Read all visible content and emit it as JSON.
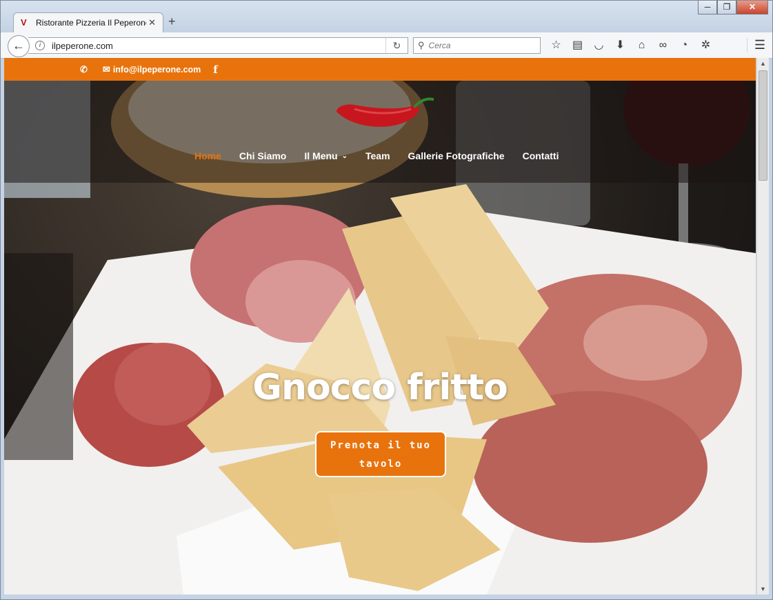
{
  "browser": {
    "tab_title": "Ristorante Pizzeria Il Peperone",
    "tab_close": "✕",
    "new_tab": "+",
    "url": "ilpeperone.com",
    "search_placeholder": "Cerca",
    "window_controls": [
      "─",
      "❐",
      "✕"
    ],
    "toolbar_icons": [
      "star-icon",
      "reader-icon",
      "pocket-icon",
      "download-icon",
      "home-icon",
      "mask-icon",
      "history-icon",
      "puzzle-icon"
    ]
  },
  "site": {
    "topbar": {
      "phone_icon": "phone-icon",
      "email": "info@ilpeperone.com",
      "facebook_icon": "f"
    },
    "nav": {
      "items": [
        "Home",
        "Chi Siamo",
        "Il Menu",
        "Team",
        "Gallerie Fotografiche",
        "Contatti"
      ],
      "active": "Home"
    },
    "hero": {
      "title": "Gnocco fritto",
      "cta_line1": "Prenota il tuo",
      "cta_line2": "tavolo"
    }
  },
  "colors": {
    "accent": "#e8730d",
    "logo_red": "#c8161e"
  }
}
